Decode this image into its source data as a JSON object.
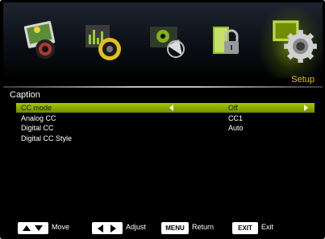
{
  "menu": {
    "icons": [
      {
        "name": "picture-icon"
      },
      {
        "name": "sound-icon"
      },
      {
        "name": "channel-icon"
      },
      {
        "name": "lock-icon"
      },
      {
        "name": "setup-gear-icon"
      }
    ],
    "active_section": "Setup",
    "accent_color": "#a9c900",
    "section_label_color": "#e6c51a"
  },
  "panel": {
    "title": "Caption",
    "rows": [
      {
        "label": "CC mode",
        "value": "Off",
        "selected": true
      },
      {
        "label": "Analog CC",
        "value": "CC1",
        "selected": false
      },
      {
        "label": "Digital CC",
        "value": "Auto",
        "selected": false
      },
      {
        "label": "Digital CC Style",
        "value": "",
        "selected": false
      }
    ]
  },
  "help": {
    "move": "Move",
    "adjust": "Adjust",
    "menu_key": "MENU",
    "return": "Return",
    "exit_key": "EXIT",
    "exit": "Exit"
  }
}
